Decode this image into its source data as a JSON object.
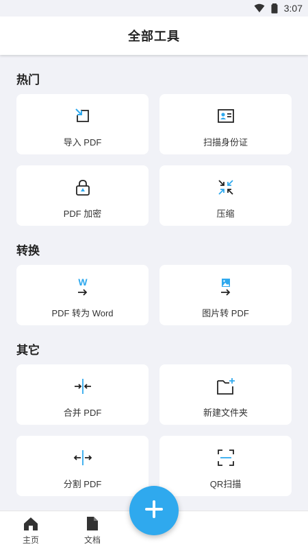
{
  "status_bar": {
    "time": "3:07",
    "icons": [
      "wifi-icon",
      "battery-icon"
    ]
  },
  "header": {
    "title": "全部工具"
  },
  "sections": [
    {
      "title": "热门",
      "items": [
        {
          "label": "导入 PDF",
          "icon": "import-icon"
        },
        {
          "label": "扫描身份证",
          "icon": "id-card-icon"
        },
        {
          "label": "PDF 加密",
          "icon": "lock-icon"
        },
        {
          "label": "压缩",
          "icon": "compress-icon"
        }
      ]
    },
    {
      "title": "转换",
      "items": [
        {
          "label": "PDF 转为 Word",
          "icon": "word-icon"
        },
        {
          "label": "图片转 PDF",
          "icon": "image-icon"
        }
      ]
    },
    {
      "title": "其它",
      "items": [
        {
          "label": "合并 PDF",
          "icon": "merge-icon"
        },
        {
          "label": "新建文件夹",
          "icon": "new-folder-icon"
        },
        {
          "label": "分割 PDF",
          "icon": "split-icon"
        },
        {
          "label": "QR扫描",
          "icon": "qr-scan-icon"
        }
      ]
    }
  ],
  "bottom_nav": [
    {
      "label": "主页",
      "icon": "home-icon"
    },
    {
      "label": "文档",
      "icon": "document-icon"
    }
  ],
  "fab": {
    "icon": "plus-icon"
  },
  "colors": {
    "accent": "#2fa9ee",
    "icon_dark": "#222222",
    "background": "#f1f2f7"
  }
}
